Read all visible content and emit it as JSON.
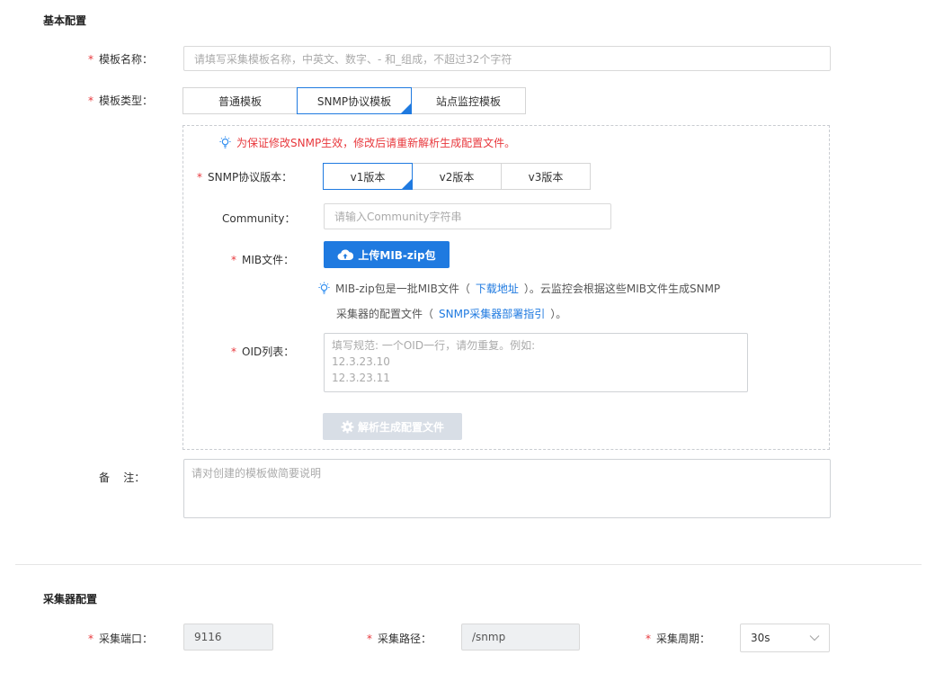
{
  "basic": {
    "section_title": "基本配置",
    "name": {
      "label": "模板名称：",
      "placeholder": "请填写采集模板名称，中英文、数字、- 和_组成，不超过32个字符"
    },
    "type": {
      "label": "模板类型：",
      "options": [
        "普通模板",
        "SNMP协议模板",
        "站点监控模板"
      ],
      "selected": "SNMP协议模板"
    },
    "warning_tip": "为保证修改SNMP生效，修改后请重新解析生成配置文件。",
    "snmp_version": {
      "label": "SNMP协议版本：",
      "options": [
        "v1版本",
        "v2版本",
        "v3版本"
      ],
      "selected": "v1版本"
    },
    "community": {
      "label": "Community：",
      "placeholder": "请输入Community字符串"
    },
    "mib": {
      "label": "MIB文件：",
      "upload_label": "上传MIB-zip包",
      "tip_line1_pre": "MIB-zip包是一批MIB文件（",
      "tip_link1": "下载地址",
      "tip_line1_post": "）。云监控会根据这些MIB文件生成SNMP",
      "tip_line2_pre": "采集器的配置文件（",
      "tip_link2": "SNMP采集器部署指引",
      "tip_line2_post": "）。"
    },
    "oid": {
      "label": "OID列表：",
      "placeholder_lines": [
        "填写规范: 一个OID一行，请勿重复。例如:",
        "12.3.23.10",
        "12.3.23.11"
      ]
    },
    "parse_button": "解析生成配置文件",
    "remark": {
      "label": "备    注：",
      "placeholder": "请对创建的模板做简要说明"
    }
  },
  "collector": {
    "section_title": "采集器配置",
    "port": {
      "label": "采集端口：",
      "value": "9116"
    },
    "path": {
      "label": "采集路径：",
      "value": "/snmp"
    },
    "period": {
      "label": "采集周期：",
      "value": "30s"
    }
  },
  "colors": {
    "primary": "#1f7ae0",
    "required": "#e8383d",
    "warning": "#e8383d",
    "tip_icon": "#2d8cf0",
    "disabled": "#d8dee6"
  }
}
